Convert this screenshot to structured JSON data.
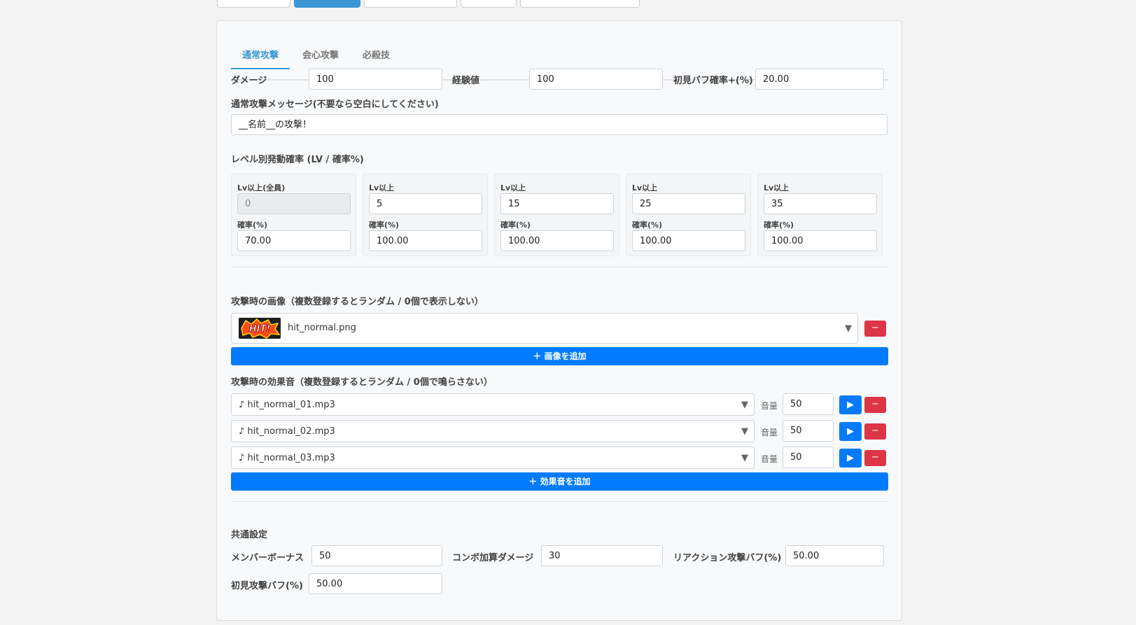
{
  "tabs": [
    "通常攻撃",
    "会心攻撃",
    "必殺技"
  ],
  "fields": {
    "damage": {
      "label": "ダメージ",
      "value": "100"
    },
    "exp": {
      "label": "経験値",
      "value": "100"
    },
    "first_buff": {
      "label": "初見バフ確率+(%)",
      "value": "20.00"
    },
    "message": {
      "label": "通常攻撃メッセージ(不要なら空白にしてください)",
      "value": "__名前__の攻撃！"
    }
  },
  "level_section": {
    "title": "レベル別発動確率 (LV / 確率%)",
    "cards": [
      {
        "lv_label": "Lv以上(全員)",
        "lv": "0",
        "rate_label": "確率(%)",
        "rate": "70.00"
      },
      {
        "lv_label": "Lv以上",
        "lv": "5",
        "rate_label": "確率(%)",
        "rate": "100.00"
      },
      {
        "lv_label": "Lv以上",
        "lv": "15",
        "rate_label": "確率(%)",
        "rate": "100.00"
      },
      {
        "lv_label": "Lv以上",
        "lv": "25",
        "rate_label": "確率(%)",
        "rate": "100.00"
      },
      {
        "lv_label": "Lv以上",
        "lv": "35",
        "rate_label": "確率(%)",
        "rate": "100.00"
      }
    ]
  },
  "image_section": {
    "title": "攻撃時の画像（複数登録するとランダム / 0個で表示しない）",
    "items": [
      {
        "file": "hit_normal.png",
        "thumb_text": "HIT!"
      }
    ],
    "add_label": "＋ 画像を追加"
  },
  "sound_section": {
    "title": "攻撃時の効果音（複数登録するとランダム / 0個で鳴らさない）",
    "volume_label": "音量",
    "items": [
      {
        "file": "♪ hit_normal_01.mp3",
        "volume": "50"
      },
      {
        "file": "♪ hit_normal_02.mp3",
        "volume": "50"
      },
      {
        "file": "♪ hit_normal_03.mp3",
        "volume": "50"
      }
    ],
    "add_label": "＋ 効果音を追加"
  },
  "common": {
    "title": "共通設定",
    "member_bonus": {
      "label": "メンバーボーナス",
      "value": "50"
    },
    "combo_damage": {
      "label": "コンボ加算ダメージ",
      "value": "30"
    },
    "reaction_buff": {
      "label": "リアクション攻撃バフ(%)",
      "value": "50.00"
    },
    "first_attack_buff": {
      "label": "初見攻撃バフ(%)",
      "value": "50.00"
    }
  },
  "icons": {
    "dropdown": "▼",
    "play": "▶",
    "remove": "−"
  },
  "colors": {
    "accent": "#3a97d3",
    "primary": "#007bff",
    "danger": "#dc3545"
  }
}
